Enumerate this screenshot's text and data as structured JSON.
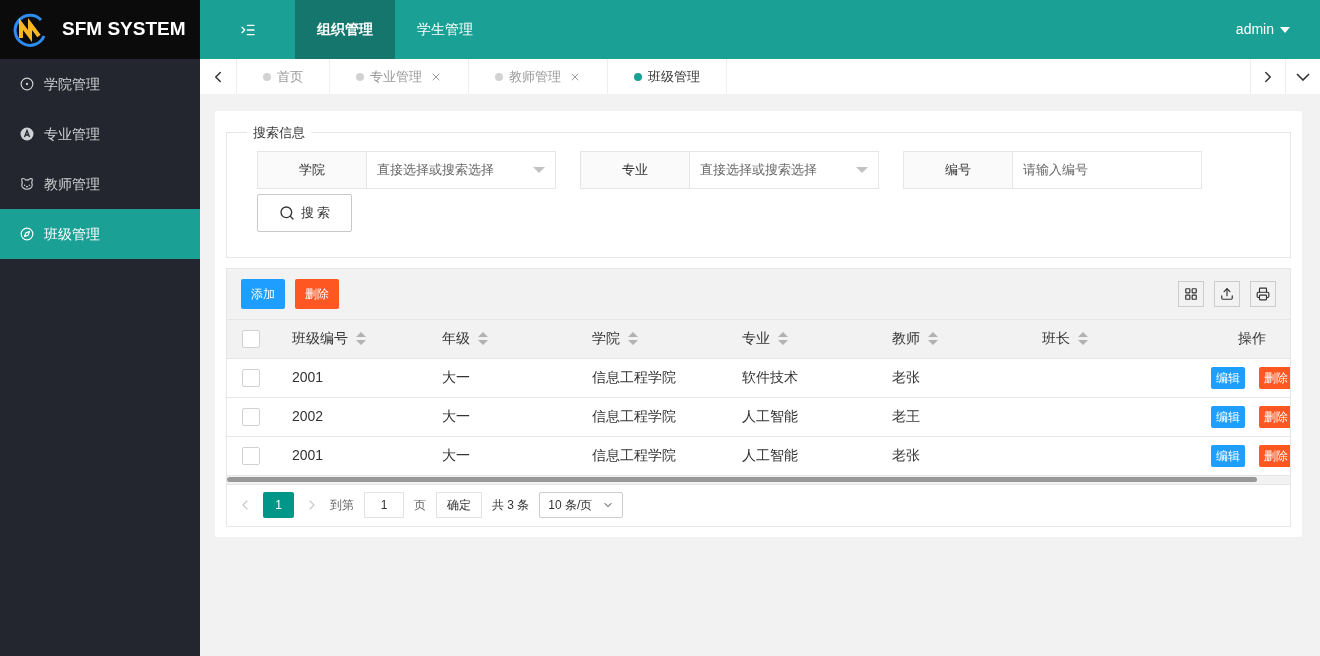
{
  "brand": {
    "title": "SFM SYSTEM"
  },
  "top_nav": [
    {
      "label": "组织管理",
      "selected": true
    },
    {
      "label": "学生管理",
      "selected": false
    }
  ],
  "user": {
    "name": "admin"
  },
  "sidebar": {
    "items": [
      {
        "label": "学院管理",
        "selected": false
      },
      {
        "label": "专业管理",
        "selected": false
      },
      {
        "label": "教师管理",
        "selected": false
      },
      {
        "label": "班级管理",
        "selected": true
      }
    ]
  },
  "page_tabs": [
    {
      "label": "首页",
      "closable": false,
      "selected": false
    },
    {
      "label": "专业管理",
      "closable": true,
      "selected": false
    },
    {
      "label": "教师管理",
      "closable": true,
      "selected": false
    },
    {
      "label": "班级管理",
      "closable": false,
      "selected": true
    }
  ],
  "search": {
    "legend": "搜索信息",
    "fields": [
      {
        "label": "学院",
        "kind": "select",
        "placeholder": "直接选择或搜索选择"
      },
      {
        "label": "专业",
        "kind": "select",
        "placeholder": "直接选择或搜索选择"
      },
      {
        "label": "编号",
        "kind": "input",
        "placeholder": "请输入编号"
      }
    ],
    "button": "搜 索"
  },
  "toolbar": {
    "add": "添加",
    "delete": "删除"
  },
  "table": {
    "header_checked": false,
    "columns": [
      {
        "label": "班级编号",
        "sortable": true
      },
      {
        "label": "年级",
        "sortable": true
      },
      {
        "label": "学院",
        "sortable": true
      },
      {
        "label": "专业",
        "sortable": true
      },
      {
        "label": "教师",
        "sortable": true
      },
      {
        "label": "班长",
        "sortable": true
      },
      {
        "label": "操作",
        "sortable": false
      }
    ],
    "rows": [
      {
        "checked": false,
        "cells": [
          "2001",
          "大一",
          "信息工程学院",
          "软件技术",
          "老张",
          ""
        ],
        "actions": [
          "编辑",
          "删除"
        ]
      },
      {
        "checked": false,
        "cells": [
          "2002",
          "大一",
          "信息工程学院",
          "人工智能",
          "老王",
          ""
        ],
        "actions": [
          "编辑",
          "删除"
        ]
      },
      {
        "checked": false,
        "cells": [
          "2001",
          "大一",
          "信息工程学院",
          "人工智能",
          "老张",
          ""
        ],
        "actions": [
          "编辑",
          "删除"
        ]
      }
    ]
  },
  "pagination": {
    "pages": [
      {
        "label": "1",
        "selected": true
      }
    ],
    "goto_label": "到第",
    "goto_value": "1",
    "page_unit": "页",
    "confirm": "确定",
    "total": "共 3 条",
    "page_size": "10 条/页"
  }
}
